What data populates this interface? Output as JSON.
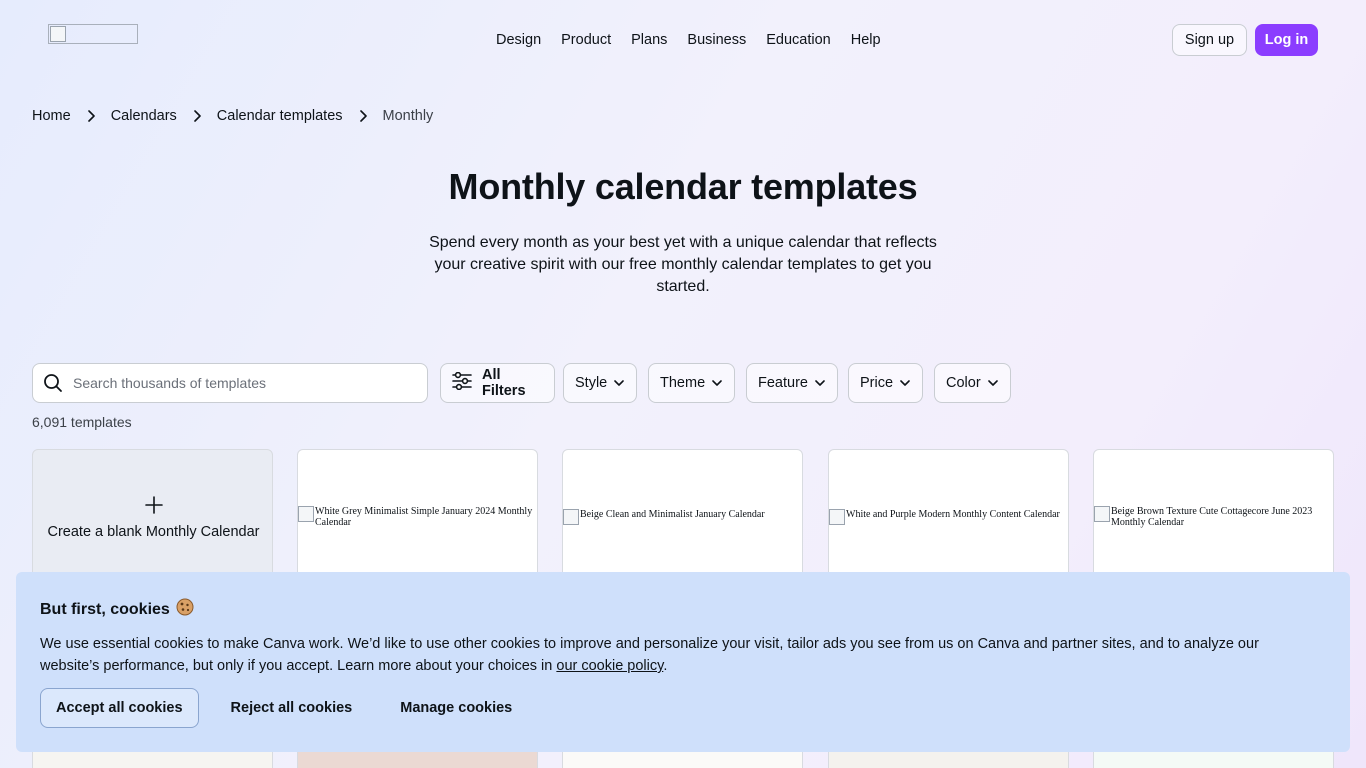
{
  "nav": {
    "items": [
      "Design",
      "Product",
      "Plans",
      "Business",
      "Education",
      "Help"
    ],
    "signup_label": "Sign up",
    "login_label": "Log in"
  },
  "breadcrumb": [
    "Home",
    "Calendars",
    "Calendar templates",
    "Monthly"
  ],
  "hero": {
    "title": "Monthly calendar templates",
    "subtitle": "Spend every month as your best yet with a unique calendar that reflects your creative spirit with our free monthly calendar templates to get you started."
  },
  "search": {
    "placeholder": "Search thousands of templates",
    "value": ""
  },
  "filters": {
    "all_label": "All Filters",
    "dropdowns": [
      "Style",
      "Theme",
      "Feature",
      "Price",
      "Color"
    ]
  },
  "results": {
    "count_text": "6,091 templates"
  },
  "cards": {
    "blank_label": "Create a blank Monthly Calendar",
    "templates": [
      "White Grey Minimalist Simple January 2024 Monthly Calendar",
      "Beige Clean and Minimalist January Calendar",
      "White and Purple Modern Monthly Content Calendar",
      "Beige Brown Texture Cute Cottagecore June 2023 Monthly Calendar"
    ]
  },
  "cookie": {
    "title": "But first, cookies",
    "text_before_link": "We use essential cookies to make Canva work. We’d like to use other cookies to improve and personalize your visit, tailor ads you see from us on Canva and partner sites, and to analyze our website’s performance, but only if you accept. Learn more about your choices in ",
    "link_text": "our cookie policy",
    "text_after_link": ".",
    "accept_label": "Accept all cookies",
    "reject_label": "Reject all cookies",
    "manage_label": "Manage cookies"
  },
  "colors": {
    "brand_purple": "#8b3dff",
    "cookie_bg": "#cfe0fb"
  },
  "icons": [
    "logo-image",
    "chevron-right-icon",
    "search-icon",
    "sliders-icon",
    "chevron-down-icon",
    "plus-icon",
    "cookie-icon",
    "broken-image-icon"
  ]
}
